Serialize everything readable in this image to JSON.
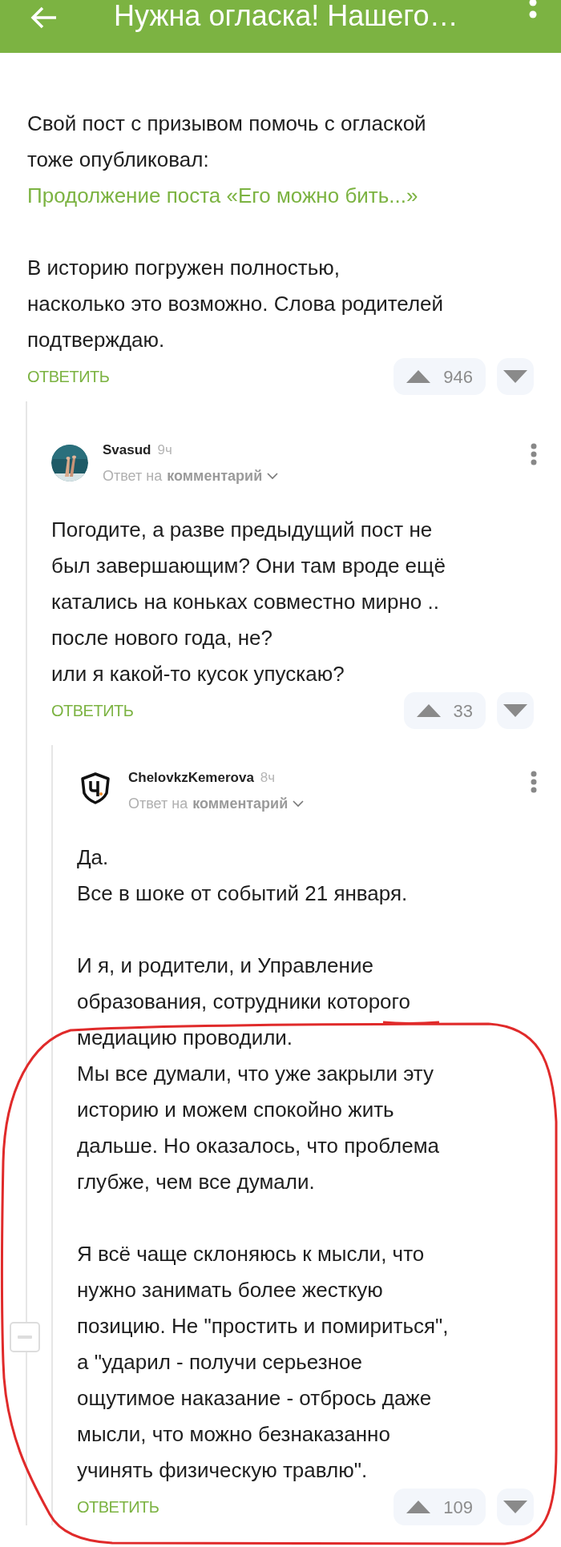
{
  "header": {
    "title": "Нужна огласка! Нашего…"
  },
  "post": {
    "paragraphs": [
      [
        {
          "kind": "text",
          "text": "Свой пост с призывом помочь с оглаской\nтоже опубликовал:"
        },
        {
          "kind": "link",
          "text": "Продолжение поста «Его можно бить...»"
        }
      ],
      [
        {
          "kind": "text",
          "text": "В историю погружен полностью,\nнасколько это возможно. Слова родителей\nподтверждаю."
        }
      ]
    ],
    "reply": "ОТВЕТИТЬ",
    "votes": "946"
  },
  "comments": [
    {
      "author": "Svasud",
      "time": "9ч",
      "reply_prefix": "Ответ на",
      "reply_target": "комментарий",
      "avatar": {
        "kind": "picture"
      },
      "paragraphs": [
        "Погодите, а разве предыдущий пост не\nбыл завершающим? Они там вроде ещё\nкатались на коньках совместно мирно ..\nпосле нового года, не?\nили я какой-то кусок упускаю?"
      ],
      "reply": "ОТВЕТИТЬ",
      "votes": "33",
      "children": [
        {
          "author": "ChelovkzKemerova",
          "time": "8ч",
          "reply_prefix": "Ответ на",
          "reply_target": "комментарий",
          "avatar": {
            "kind": "icon"
          },
          "paragraphs": [
            "Да.\nВсе в шоке от событий 21 января.",
            "И я, и родители, и Управление\nобразования, сотрудники которого\nмедиацию проводили.\nМы все думали, что уже закрыли эту\nисторию и можем спокойно жить\nдальше. Но оказалось, что проблема\nглубже, чем все думали.",
            "Я всё чаще склоняюсь к мысли, что\nнужно занимать более жесткую\nпозицию. Не \"простить и помириться\",\nа \"ударил - получи серьезное\nощутимое наказание - отбрось даже\nмысли, что можно безнаказанно\nучинять физическую травлю\"."
          ],
          "reply": "ОТВЕТИТЬ",
          "votes": "109"
        }
      ]
    }
  ]
}
